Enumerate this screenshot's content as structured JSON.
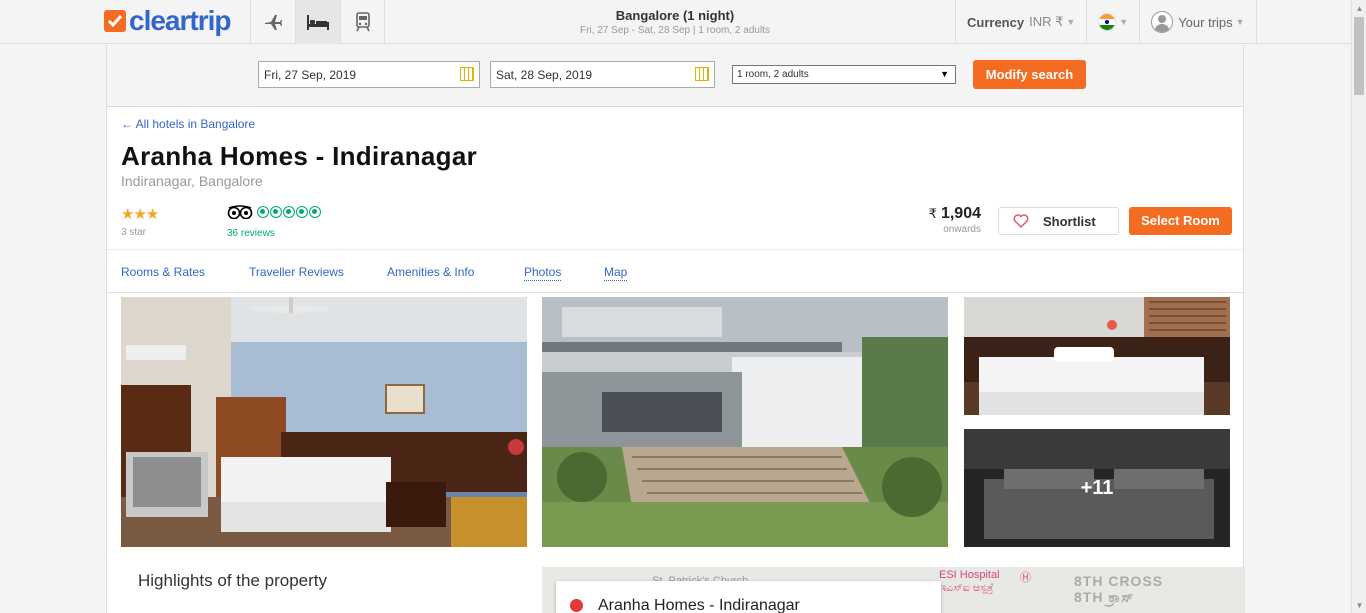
{
  "header": {
    "logo_text": "cleartrip",
    "trip_title": "Bangalore (1 night)",
    "trip_sub": "Fri, 27 Sep - Sat, 28 Sep | 1 room, 2 adults",
    "currency_label": "Currency",
    "currency_value": "INR ₹",
    "your_trips": "Your trips",
    "mode_tabs": [
      {
        "icon": "flight-icon"
      },
      {
        "icon": "hotel-icon",
        "active": true
      },
      {
        "icon": "train-icon"
      }
    ]
  },
  "search": {
    "checkin": "Fri, 27 Sep, 2019",
    "checkout": "Sat, 28 Sep, 2019",
    "rooms": "1 room, 2 adults",
    "modify_label": "Modify search"
  },
  "hotel": {
    "back_link": "← All hotels in Bangalore",
    "name": "Aranha Homes - Indiranagar",
    "location": "Indiranagar, Bangalore",
    "stars": "★★★",
    "star_label": "3 star",
    "reviews": "36 reviews",
    "tripadvisor_rating": 5,
    "price_symbol": "₹",
    "price": "1,904",
    "price_note": "onwards",
    "shortlist_label": "Shortlist",
    "select_room_label": "Select Room"
  },
  "tabs": [
    {
      "label": "Rooms & Rates"
    },
    {
      "label": "Traveller Reviews"
    },
    {
      "label": "Amenities & Info"
    },
    {
      "label": "Photos"
    },
    {
      "label": "Map"
    }
  ],
  "photos": {
    "more_count": "+11"
  },
  "highlights_title": "Highlights of the property",
  "map": {
    "hotel_name": "Aranha Homes - Indiranagar",
    "labels": {
      "church": "St. Patrick's Church",
      "hospital": "ESI Hospital",
      "hospital_local": "ಇಎಸ್ಐ ಆಸ್ಪತ್ರೆ",
      "cross_en": "8TH CROSS",
      "cross_local": "8TH ಕ್ರಾಸ್"
    }
  },
  "colors": {
    "brand_orange": "#f36c21",
    "link_blue": "#3366cc",
    "tripadvisor_green": "#00aa6c"
  }
}
